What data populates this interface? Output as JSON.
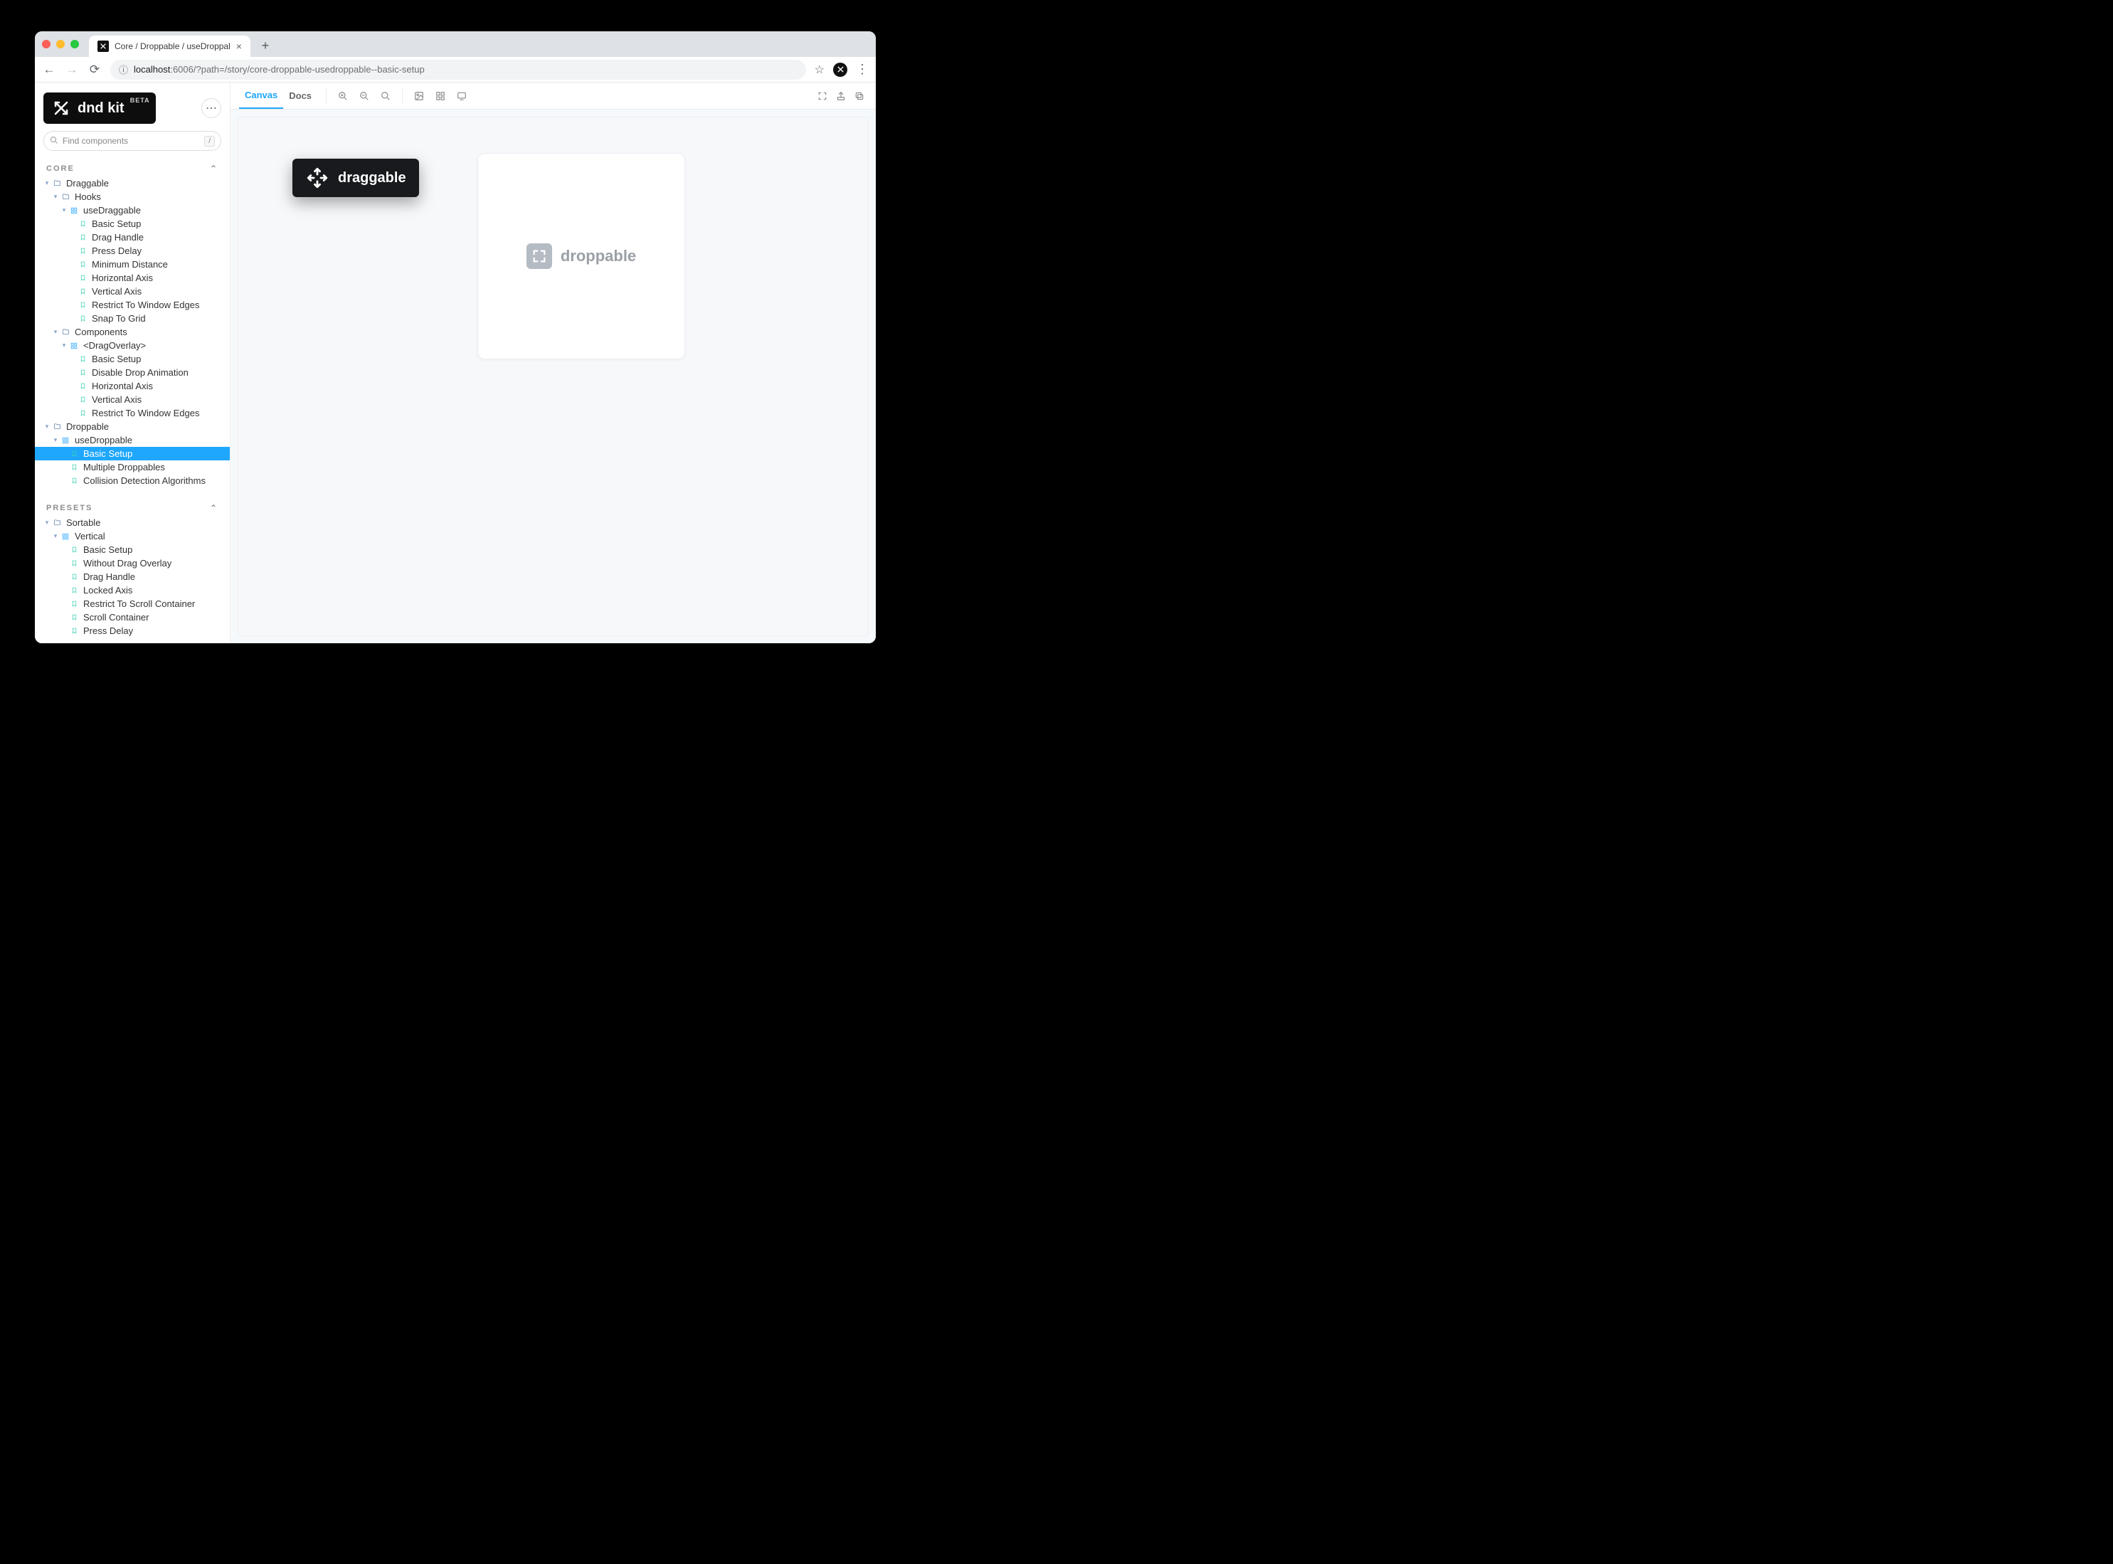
{
  "browser": {
    "tabTitle": "Core / Droppable / useDroppal",
    "url_host": "localhost",
    "url_port": ":6006",
    "url_path": "/?path=/story/core-droppable-usedroppable--basic-setup"
  },
  "brand": {
    "name": "dnd kit",
    "badge": "BETA"
  },
  "search": {
    "placeholder": "Find components",
    "shortcut": "/"
  },
  "sections": [
    {
      "title": "CORE",
      "rows": [
        {
          "indent": 0,
          "caret": "▾",
          "ico": "folder",
          "label": "Draggable"
        },
        {
          "indent": 1,
          "caret": "▾",
          "ico": "folder",
          "label": "Hooks"
        },
        {
          "indent": 2,
          "caret": "▾",
          "ico": "grid",
          "label": "useDraggable"
        },
        {
          "indent": 3,
          "caret": "",
          "ico": "story",
          "label": "Basic Setup"
        },
        {
          "indent": 3,
          "caret": "",
          "ico": "story",
          "label": "Drag Handle"
        },
        {
          "indent": 3,
          "caret": "",
          "ico": "story",
          "label": "Press Delay"
        },
        {
          "indent": 3,
          "caret": "",
          "ico": "story",
          "label": "Minimum Distance"
        },
        {
          "indent": 3,
          "caret": "",
          "ico": "story",
          "label": "Horizontal Axis"
        },
        {
          "indent": 3,
          "caret": "",
          "ico": "story",
          "label": "Vertical Axis"
        },
        {
          "indent": 3,
          "caret": "",
          "ico": "story",
          "label": "Restrict To Window Edges"
        },
        {
          "indent": 3,
          "caret": "",
          "ico": "story",
          "label": "Snap To Grid"
        },
        {
          "indent": 1,
          "caret": "▾",
          "ico": "folder",
          "label": "Components"
        },
        {
          "indent": 2,
          "caret": "▾",
          "ico": "grid",
          "label": "<DragOverlay>"
        },
        {
          "indent": 3,
          "caret": "",
          "ico": "story",
          "label": "Basic Setup"
        },
        {
          "indent": 3,
          "caret": "",
          "ico": "story",
          "label": "Disable Drop Animation"
        },
        {
          "indent": 3,
          "caret": "",
          "ico": "story",
          "label": "Horizontal Axis"
        },
        {
          "indent": 3,
          "caret": "",
          "ico": "story",
          "label": "Vertical Axis"
        },
        {
          "indent": 3,
          "caret": "",
          "ico": "story",
          "label": "Restrict To Window Edges"
        },
        {
          "indent": 0,
          "caret": "▾",
          "ico": "folder",
          "label": "Droppable"
        },
        {
          "indent": 1,
          "caret": "▾",
          "ico": "grid",
          "label": "useDroppable"
        },
        {
          "indent": 2,
          "caret": "",
          "ico": "story",
          "label": "Basic Setup",
          "selected": true
        },
        {
          "indent": 2,
          "caret": "",
          "ico": "story",
          "label": "Multiple Droppables"
        },
        {
          "indent": 2,
          "caret": "",
          "ico": "story",
          "label": "Collision Detection Algorithms"
        }
      ]
    },
    {
      "title": "PRESETS",
      "rows": [
        {
          "indent": 0,
          "caret": "▾",
          "ico": "folder",
          "label": "Sortable"
        },
        {
          "indent": 1,
          "caret": "▾",
          "ico": "grid",
          "label": "Vertical"
        },
        {
          "indent": 2,
          "caret": "",
          "ico": "story",
          "label": "Basic Setup"
        },
        {
          "indent": 2,
          "caret": "",
          "ico": "story",
          "label": "Without Drag Overlay"
        },
        {
          "indent": 2,
          "caret": "",
          "ico": "story",
          "label": "Drag Handle"
        },
        {
          "indent": 2,
          "caret": "",
          "ico": "story",
          "label": "Locked Axis"
        },
        {
          "indent": 2,
          "caret": "",
          "ico": "story",
          "label": "Restrict To Scroll Container"
        },
        {
          "indent": 2,
          "caret": "",
          "ico": "story",
          "label": "Scroll Container"
        },
        {
          "indent": 2,
          "caret": "",
          "ico": "story",
          "label": "Press Delay"
        }
      ]
    }
  ],
  "toolbar": {
    "tabs": [
      {
        "label": "Canvas",
        "active": true
      },
      {
        "label": "Docs",
        "active": false
      }
    ]
  },
  "stage": {
    "draggableLabel": "draggable",
    "droppableLabel": "droppable"
  }
}
